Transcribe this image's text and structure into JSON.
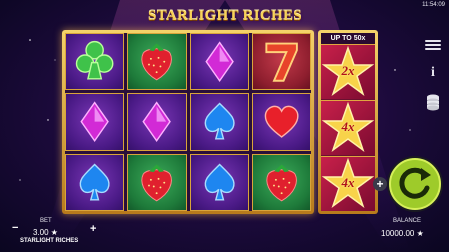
{
  "clock": "11:54:09",
  "title": "STARLIGHT RICHES",
  "multiplier_header": "UP TO 50x",
  "multipliers": [
    "2x",
    "4x",
    "4x"
  ],
  "grid": [
    [
      {
        "symbol": "club-icon",
        "bg": "purple"
      },
      {
        "symbol": "strawberry-icon",
        "bg": "green"
      },
      {
        "symbol": "diamond-icon",
        "bg": "purple"
      },
      {
        "symbol": "seven-icon",
        "bg": "red"
      }
    ],
    [
      {
        "symbol": "diamond-icon",
        "bg": "purple"
      },
      {
        "symbol": "diamond-icon",
        "bg": "purple"
      },
      {
        "symbol": "spade-icon",
        "bg": "purple"
      },
      {
        "symbol": "heart-icon",
        "bg": "purple"
      }
    ],
    [
      {
        "symbol": "spade-icon",
        "bg": "purple"
      },
      {
        "symbol": "strawberry-icon",
        "bg": "green"
      },
      {
        "symbol": "spade-icon",
        "bg": "purple"
      },
      {
        "symbol": "strawberry-icon",
        "bg": "green"
      }
    ]
  ],
  "bet": {
    "label": "BET",
    "value": "3.00 ★",
    "minus": "−",
    "plus": "+"
  },
  "game_name": "STARLIGHT RICHES",
  "balance": {
    "label": "BALANCE",
    "value": "10000.00 ★"
  },
  "side_buttons": {
    "menu": "menu-icon",
    "info": "i",
    "coins": "coins-icon"
  },
  "spin_plus": "+",
  "colors": {
    "gold": "#f7d25a",
    "spin": "#9ecb2a",
    "multiplier_bg": "#c8204a"
  }
}
